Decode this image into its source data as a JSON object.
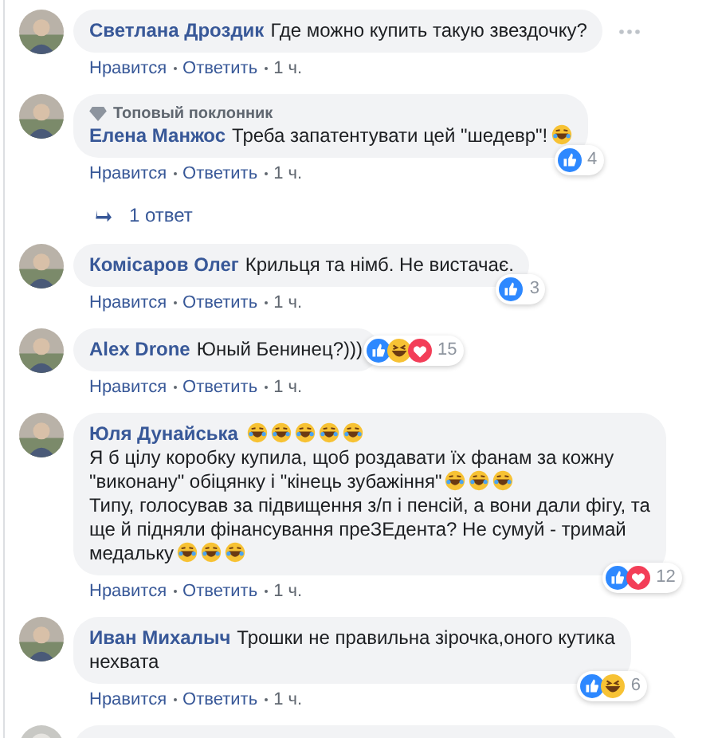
{
  "comments": [
    {
      "kind": "comment",
      "name": "Светлана Дроздик",
      "parts": [
        {
          "kind": "text",
          "text": "Где можно купить такую звездочку?"
        }
      ],
      "more_options": true,
      "actions": [
        "Нравится",
        "Ответить",
        "1 ч."
      ]
    },
    {
      "kind": "comment",
      "badge": "Топовый поклонник",
      "name": "Елена Манжос",
      "parts": [
        {
          "kind": "text",
          "text": "Треба запатентувати цей \"шедевр\"!"
        },
        {
          "kind": "emoji"
        }
      ],
      "reactions": {
        "icons": [
          {
            "kind": "like"
          }
        ],
        "count": "4"
      },
      "actions": [
        "Нравится",
        "Ответить",
        "1 ч."
      ],
      "replies": "1 ответ"
    },
    {
      "kind": "comment",
      "name": "Комісаров Олег",
      "parts": [
        {
          "kind": "text",
          "text": "Крильця та німб. Не вистачає."
        }
      ],
      "reactions": {
        "icons": [
          {
            "kind": "like"
          }
        ],
        "count": "3"
      },
      "actions": [
        "Нравится",
        "Ответить",
        "1 ч."
      ]
    },
    {
      "kind": "comment",
      "name": "Alex Drone",
      "parts": [
        {
          "kind": "text",
          "text": "Юный Бенинец?)))"
        }
      ],
      "reactions": {
        "icons": [
          {
            "kind": "like"
          },
          {
            "kind": "haha"
          },
          {
            "kind": "love"
          }
        ],
        "count": "15"
      },
      "inline_reactions": true,
      "actions": [
        "Нравится",
        "Ответить",
        "1 ч."
      ]
    },
    {
      "kind": "comment",
      "name": "Юля Дунайська",
      "parts": [
        {
          "kind": "emoji"
        },
        {
          "kind": "emoji"
        },
        {
          "kind": "emoji"
        },
        {
          "kind": "emoji"
        },
        {
          "kind": "emoji"
        },
        {
          "kind": "break"
        },
        {
          "kind": "text",
          "text": "Я б цілу коробку купила, щоб роздавати їх фанам за кожну"
        },
        {
          "kind": "break"
        },
        {
          "kind": "text",
          "text": "\"виконану\" обіцянку і \"кінець зубажіння\""
        },
        {
          "kind": "emoji"
        },
        {
          "kind": "emoji"
        },
        {
          "kind": "emoji"
        },
        {
          "kind": "break"
        },
        {
          "kind": "text",
          "text": "Типу, голосував за підвищення з/п і пенсій, а вони дали фігу, та"
        },
        {
          "kind": "break"
        },
        {
          "kind": "text",
          "text": "ще й підняли фінансування преЗЕдента? Не сумуй - тримай"
        },
        {
          "kind": "break"
        },
        {
          "kind": "text",
          "text": "медальку"
        },
        {
          "kind": "emoji"
        },
        {
          "kind": "emoji"
        },
        {
          "kind": "emoji"
        }
      ],
      "reactions": {
        "icons": [
          {
            "kind": "like"
          },
          {
            "kind": "love"
          }
        ],
        "count": "12"
      },
      "actions": [
        "Нравится",
        "Ответить",
        "1 ч."
      ]
    },
    {
      "kind": "comment",
      "name": "Иван Михалыч",
      "parts": [
        {
          "kind": "text",
          "text": "Трошки не правильна зірочка,оного кутика"
        },
        {
          "kind": "break"
        },
        {
          "kind": "text",
          "text": "нехвата"
        }
      ],
      "reactions": {
        "icons": [
          {
            "kind": "like"
          },
          {
            "kind": "haha"
          }
        ],
        "count": "6"
      },
      "actions": [
        "Нравится",
        "Ответить",
        "1 ч."
      ]
    },
    {
      "kind": "cut"
    }
  ]
}
